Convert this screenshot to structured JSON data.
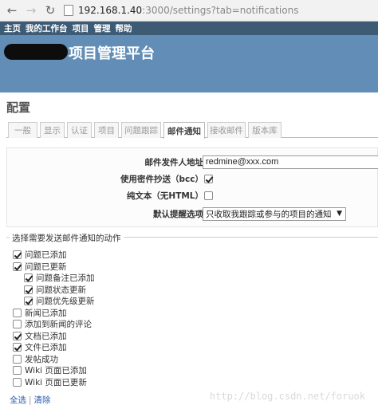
{
  "browser": {
    "url_host": "192.168.1.40",
    "url_rest": ":3000/settings?tab=notifications"
  },
  "topmenu": [
    "主页",
    "我的工作台",
    "项目",
    "管理",
    "帮助"
  ],
  "header": {
    "title": "项目管理平台"
  },
  "page_title": "配置",
  "tabs": [
    "一般",
    "显示",
    "认证",
    "项目",
    "问题跟踪",
    "邮件通知",
    "接收邮件",
    "版本库"
  ],
  "active_tab": "邮件通知",
  "settings": {
    "from_label": "邮件发件人地址",
    "from_value": "redmine@xxx.com",
    "bcc_label": "使用密件抄送（bcc）",
    "bcc_checked": true,
    "plain_label": "纯文本（无HTML）",
    "plain_checked": false,
    "default_label": "默认提醒选项",
    "default_value": "只收取我跟踪或参与的项目的通知"
  },
  "actions": {
    "legend": "选择需要发送邮件通知的动作",
    "items": [
      {
        "label": "问题已添加",
        "checked": true,
        "indent": 0
      },
      {
        "label": "问题已更新",
        "checked": true,
        "indent": 0
      },
      {
        "label": "问题备注已添加",
        "checked": true,
        "indent": 1
      },
      {
        "label": "问题状态更新",
        "checked": true,
        "indent": 1
      },
      {
        "label": "问题优先级更新",
        "checked": true,
        "indent": 1
      },
      {
        "label": "新闻已添加",
        "checked": false,
        "indent": 0
      },
      {
        "label": "添加到新闻的评论",
        "checked": false,
        "indent": 0
      },
      {
        "label": "文档已添加",
        "checked": true,
        "indent": 0
      },
      {
        "label": "文件已添加",
        "checked": true,
        "indent": 0
      },
      {
        "label": "发帖成功",
        "checked": false,
        "indent": 0
      },
      {
        "label": "Wiki 页面已添加",
        "checked": false,
        "indent": 0
      },
      {
        "label": "Wiki 页面已更新",
        "checked": false,
        "indent": 0
      }
    ]
  },
  "links": {
    "select_all": "全选",
    "clear": "清除",
    "sep": "|"
  },
  "watermark": "http://blog.csdn.net/foruok",
  "icons": {
    "back": "back-arrow-icon",
    "forward": "forward-arrow-icon",
    "reload": "reload-icon",
    "page": "page-icon",
    "dropdown": "chevron-down-icon"
  }
}
